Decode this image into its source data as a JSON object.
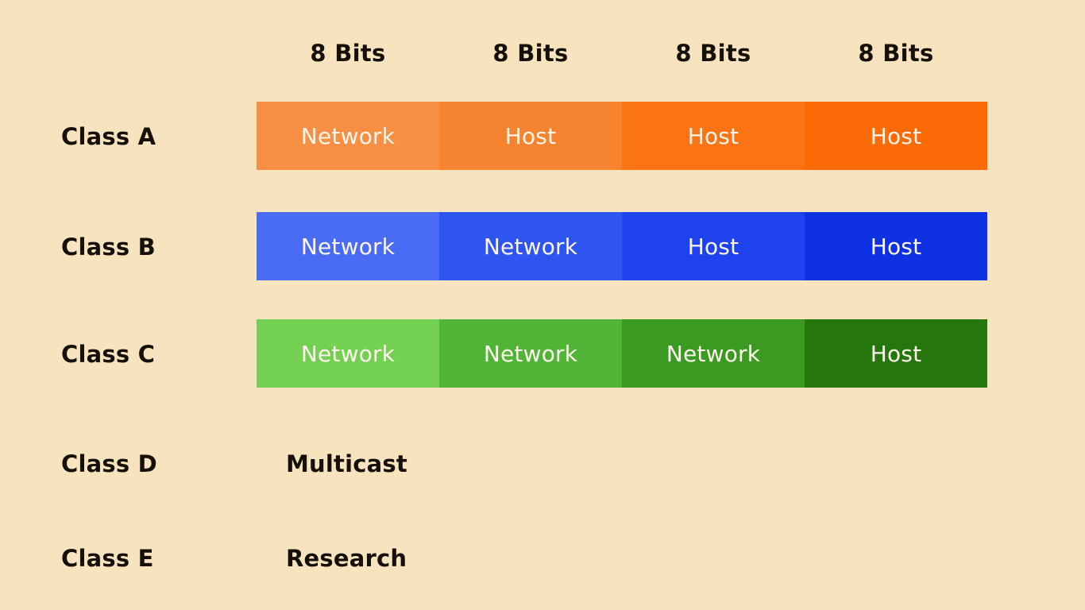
{
  "page": {
    "background_color": "#f8e3bf",
    "text_color": "#16100a",
    "segment_text_color": "#fdf6ec"
  },
  "header": {
    "bit_labels": [
      {
        "text": "8 Bits"
      },
      {
        "text": "8 Bits"
      },
      {
        "text": "8 Bits"
      },
      {
        "text": "8 Bits"
      }
    ]
  },
  "rows": [
    {
      "class_label": "Class A",
      "kind": "bar",
      "segments": [
        {
          "label": "Network",
          "color": "#f79045"
        },
        {
          "label": "Host",
          "color": "#f5832f"
        },
        {
          "label": "Host",
          "color": "#fa7315"
        },
        {
          "label": "Host",
          "color": "#fb6a07"
        }
      ]
    },
    {
      "class_label": "Class B",
      "kind": "bar",
      "segments": [
        {
          "label": "Network",
          "color": "#4a6cf5"
        },
        {
          "label": "Network",
          "color": "#2f55f0"
        },
        {
          "label": "Host",
          "color": "#1f42ef"
        },
        {
          "label": "Host",
          "color": "#0e31e3"
        }
      ]
    },
    {
      "class_label": "Class C",
      "kind": "bar",
      "segments": [
        {
          "label": "Network",
          "color": "#74d052"
        },
        {
          "label": "Network",
          "color": "#50b436"
        },
        {
          "label": "Network",
          "color": "#3a9a22"
        },
        {
          "label": "Host",
          "color": "#24760d"
        }
      ]
    },
    {
      "class_label": "Class D",
      "kind": "text",
      "text": "Multicast"
    },
    {
      "class_label": "Class E",
      "kind": "text",
      "text": "Research"
    }
  ]
}
